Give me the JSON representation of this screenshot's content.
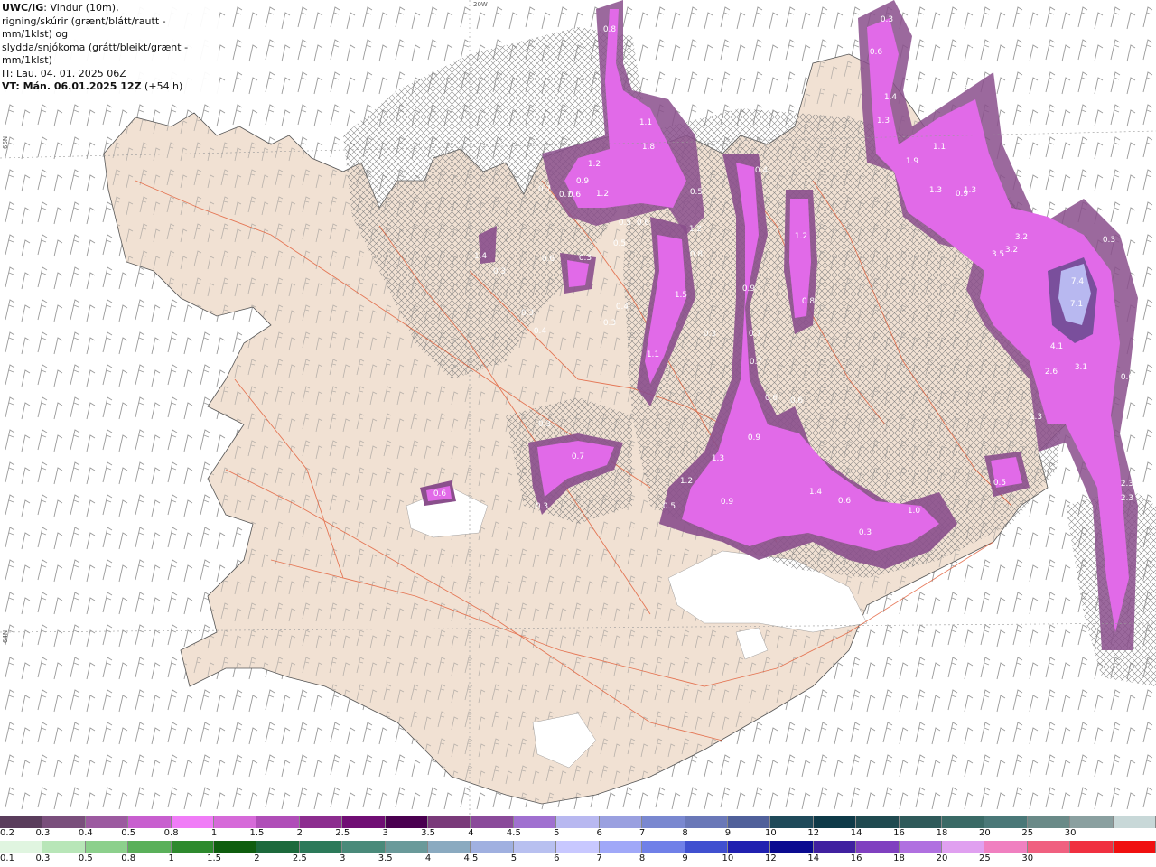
{
  "header": {
    "model": "UWC/IG",
    "desc": ": Vindur (10m),",
    "line2": "rigning/skúrir (grænt/blátt/rautt - mm/1klst) og",
    "line3": "slydda/snjókoma (grátt/bleikt/grænt - mm/1klst)",
    "line4": "IT: Lau. 04. 01. 2025 06Z",
    "vt_label": "VT: Mán. 06.01.2025 12Z",
    "vt_offset": " (+54 h)"
  },
  "grid_labels": {
    "top": "20W",
    "left_upper": "66N",
    "left_lower": "64N"
  },
  "precip_labels": [
    "0.8",
    "1.1",
    "1.8",
    "0.4",
    "0.4",
    "0.3",
    "1.4",
    "1.3",
    "1.1",
    "1.9",
    "0.6",
    "1.3",
    "0.4",
    "1.3",
    "0.9",
    "0.7",
    "0.7",
    "0.6",
    "0.9",
    "1.2",
    "1.2",
    "0.5",
    "0.4",
    "0.6",
    "0.5",
    "0.5",
    "0.6",
    "0.3",
    "1.4",
    "0.3",
    "0.3",
    "0.4",
    "0.4",
    "0.3",
    "1.5",
    "1.2",
    "3.5",
    "3.2",
    "3.2",
    "0.8",
    "1.3",
    "0.9",
    "0.8",
    "0.3",
    "0.7",
    "0.7",
    "7.4",
    "7.1",
    "4.1",
    "3.1",
    "2.6",
    "1.1",
    "1.2",
    "0.6",
    "0.6",
    "0.3",
    "0.9",
    "1.3",
    "1.3",
    "1.2",
    "0.7",
    "0.6",
    "0.5",
    "0.9",
    "1.4",
    "0.6",
    "1.0",
    "0.3",
    "0.5",
    "0.3",
    "0.6",
    "0.3",
    "2.3",
    "2.3"
  ],
  "legend_snow": {
    "colors": [
      "#5a3d5c",
      "#7a4f7c",
      "#9c5aa0",
      "#c85fcf",
      "#f07cf7",
      "#d66ad9",
      "#b04eb8",
      "#8c2d8f",
      "#700e74",
      "#4a0050",
      "#7a3a7a",
      "#8a4a9a",
      "#a070d0",
      "#b8b8f0",
      "#9aa0e0",
      "#7a88d0",
      "#6a78b8",
      "#50609a",
      "#1f4a5a",
      "#0e3a48",
      "#204a50",
      "#2f5a5a",
      "#3a6a66",
      "#4a7878",
      "#6a8a88",
      "#8aa0a0",
      "#c8d8d8"
    ],
    "labels": [
      "0.2",
      "0.3",
      "0.4",
      "0.5",
      "0.8",
      "1",
      "1.5",
      "2",
      "2.5",
      "3",
      "3.5",
      "4",
      "4.5",
      "5",
      "6",
      "7",
      "8",
      "9",
      "10",
      "12",
      "14",
      "16",
      "18",
      "20",
      "25",
      "30"
    ]
  },
  "legend_rain": {
    "colors": [
      "#e0f5e0",
      "#b8e6b8",
      "#8cd08c",
      "#5ab05a",
      "#2e8a2e",
      "#0f5e0f",
      "#1c6a3c",
      "#2c7a5a",
      "#4a8a7a",
      "#6a9a9a",
      "#8aaac0",
      "#a0b0e0",
      "#b8c0f0",
      "#c8c8ff",
      "#a0a8f8",
      "#7080e8",
      "#4050d0",
      "#2020b0",
      "#0a0a90",
      "#4020a0",
      "#8040c0",
      "#b070e0",
      "#e0a0f0",
      "#f080c0",
      "#f06080",
      "#f03040",
      "#f01010"
    ],
    "labels": [
      "0.1",
      "0.3",
      "0.5",
      "0.8",
      "1",
      "1.5",
      "2",
      "2.5",
      "3",
      "3.5",
      "4",
      "4.5",
      "5",
      "6",
      "7",
      "8",
      "9",
      "10",
      "12",
      "14",
      "16",
      "18",
      "20",
      "25",
      "30"
    ]
  }
}
